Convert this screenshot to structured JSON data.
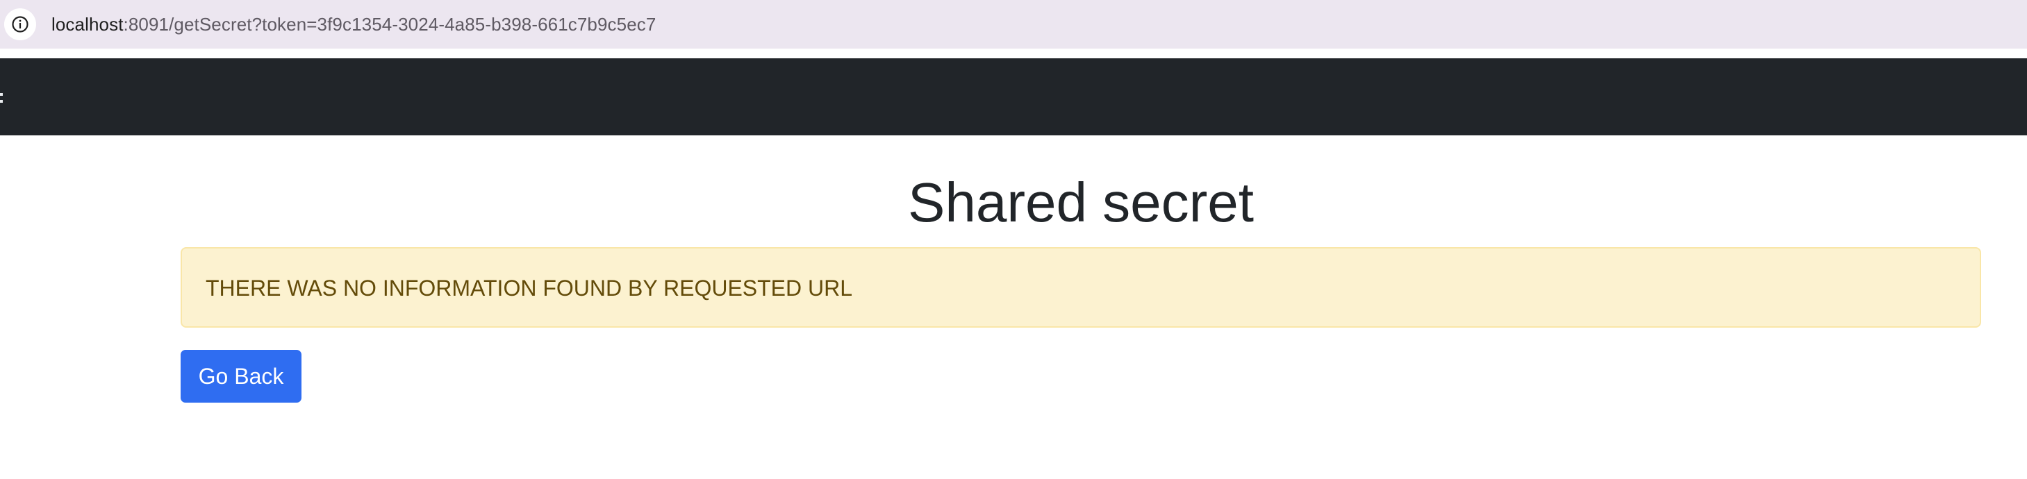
{
  "browser": {
    "url_host": "localhost",
    "url_rest": ":8091/getSecret?token=3f9c1354-3024-4a85-b398-661c7b9c5ec7",
    "site_info_icon": "info-circle-icon"
  },
  "navbar": {
    "background": "#212529"
  },
  "main": {
    "title": "Shared secret",
    "alert_message": "THERE WAS NO INFORMATION FOUND BY REQUESTED URL",
    "alert_background": "#fcf2d0",
    "alert_text_color": "#634b09",
    "back_button_label": "Go Back",
    "back_button_color": "#2f6df1"
  }
}
